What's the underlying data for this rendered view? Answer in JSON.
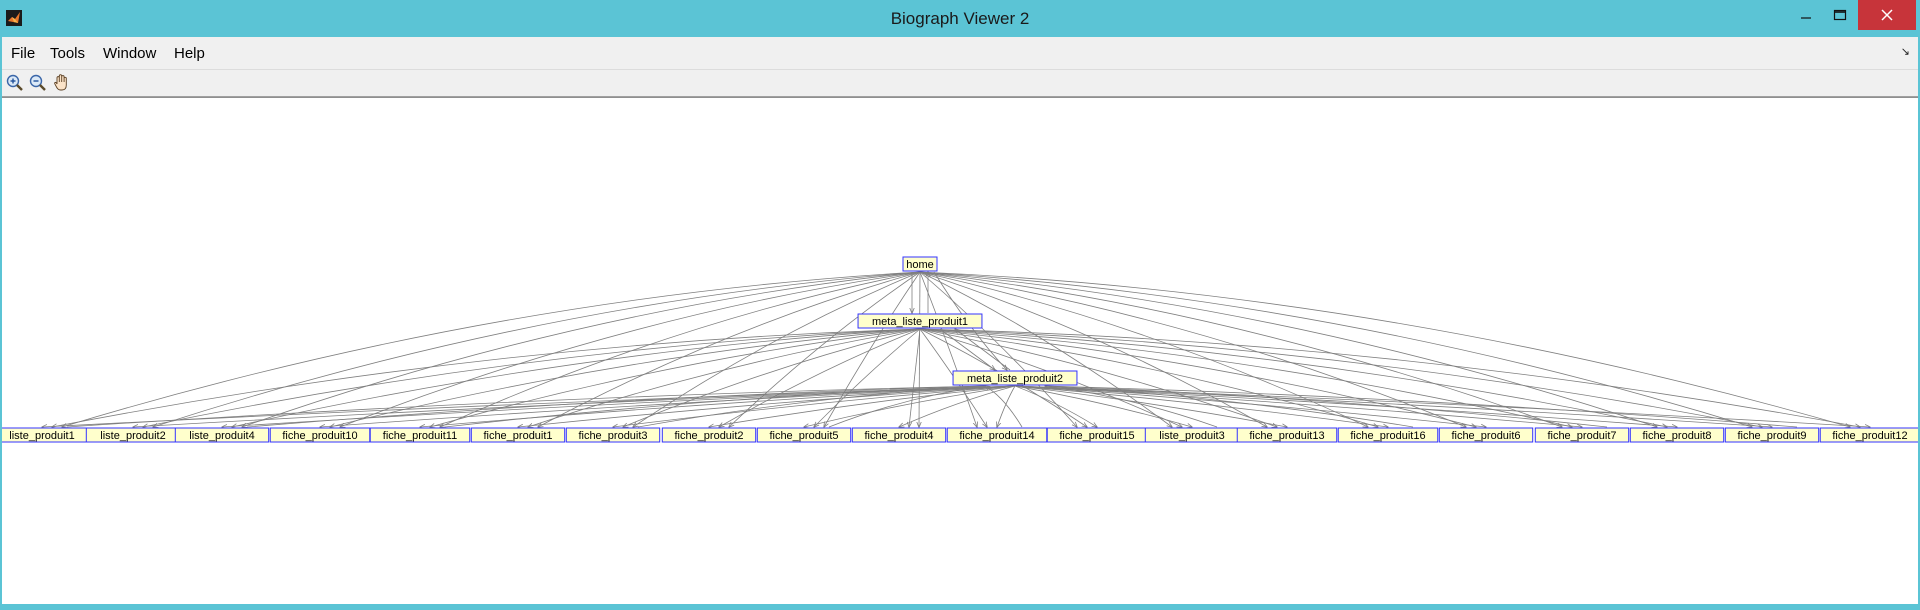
{
  "window": {
    "title": "Biograph Viewer 2",
    "minimize_glyph": "—",
    "maximize_glyph": "☐",
    "close_glyph": "✕",
    "accent_color": "#5bc4d5",
    "close_color": "#c7343a"
  },
  "menu": {
    "items": [
      "File",
      "Tools",
      "Window",
      "Help"
    ],
    "corner_glyph": "↘"
  },
  "toolbar": {
    "tools": [
      "zoom-in-icon",
      "zoom-out-icon",
      "pan-hand-icon"
    ]
  },
  "graph": {
    "node_fill": "#ffffcc",
    "node_border": "#3333ff",
    "edge_color": "#7f7f7f",
    "root": "home",
    "level1": "meta_liste_produit1",
    "level2": "meta_liste_produit2",
    "leaves": [
      "liste_produit1",
      "liste_produit2",
      "liste_produit4",
      "fiche_produit10",
      "fiche_produit11",
      "fiche_produit1",
      "fiche_produit3",
      "fiche_produit2",
      "fiche_produit5",
      "fiche_produit4",
      "fiche_produit14",
      "fiche_produit15",
      "liste_produit3",
      "fiche_produit13",
      "fiche_produit16",
      "fiche_produit6",
      "fiche_produit7",
      "fiche_produit8",
      "fiche_produit9",
      "fiche_produit12"
    ]
  }
}
